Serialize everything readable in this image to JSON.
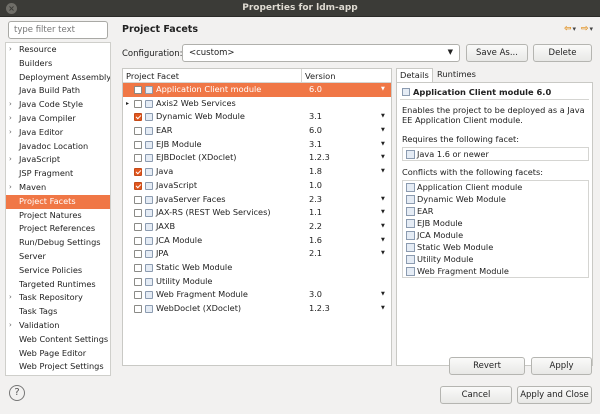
{
  "window": {
    "title": "Properties for ldm-app",
    "close": "×"
  },
  "filter": {
    "placeholder": "type filter text"
  },
  "nav": [
    {
      "label": "Resource",
      "arrow": "›"
    },
    {
      "label": "Builders",
      "arrow": ""
    },
    {
      "label": "Deployment Assembly",
      "arrow": ""
    },
    {
      "label": "Java Build Path",
      "arrow": ""
    },
    {
      "label": "Java Code Style",
      "arrow": "›"
    },
    {
      "label": "Java Compiler",
      "arrow": "›"
    },
    {
      "label": "Java Editor",
      "arrow": "›"
    },
    {
      "label": "Javadoc Location",
      "arrow": ""
    },
    {
      "label": "JavaScript",
      "arrow": "›"
    },
    {
      "label": "JSP Fragment",
      "arrow": ""
    },
    {
      "label": "Maven",
      "arrow": "›"
    },
    {
      "label": "Project Facets",
      "arrow": "",
      "selected": true
    },
    {
      "label": "Project Natures",
      "arrow": ""
    },
    {
      "label": "Project References",
      "arrow": ""
    },
    {
      "label": "Run/Debug Settings",
      "arrow": ""
    },
    {
      "label": "Server",
      "arrow": ""
    },
    {
      "label": "Service Policies",
      "arrow": ""
    },
    {
      "label": "Targeted Runtimes",
      "arrow": ""
    },
    {
      "label": "Task Repository",
      "arrow": "›"
    },
    {
      "label": "Task Tags",
      "arrow": ""
    },
    {
      "label": "Validation",
      "arrow": "›"
    },
    {
      "label": "Web Content Settings",
      "arrow": ""
    },
    {
      "label": "Web Page Editor",
      "arrow": ""
    },
    {
      "label": "Web Project Settings",
      "arrow": ""
    }
  ],
  "page": {
    "title": "Project Facets",
    "nav_back": "⇦",
    "nav_forward": "⇨",
    "nav_menu": "▾"
  },
  "config": {
    "label": "Configuration:",
    "value": "<custom>",
    "save_as": "Save As...",
    "delete": "Delete"
  },
  "facets": {
    "col_facet": "Project Facet",
    "col_version": "Version",
    "rows": [
      {
        "name": "Application Client module",
        "version": "6.0",
        "checked": false,
        "selected": true,
        "has_dd": true
      },
      {
        "name": "Axis2 Web Services",
        "version": "",
        "checked": false,
        "expander": "▸"
      },
      {
        "name": "Dynamic Web Module",
        "version": "3.1",
        "checked": true,
        "has_dd": true
      },
      {
        "name": "EAR",
        "version": "6.0",
        "checked": false,
        "has_dd": true
      },
      {
        "name": "EJB Module",
        "version": "3.1",
        "checked": false,
        "has_dd": true
      },
      {
        "name": "EJBDoclet (XDoclet)",
        "version": "1.2.3",
        "checked": false,
        "has_dd": true
      },
      {
        "name": "Java",
        "version": "1.8",
        "checked": true,
        "has_dd": true
      },
      {
        "name": "JavaScript",
        "version": "1.0",
        "checked": true
      },
      {
        "name": "JavaServer Faces",
        "version": "2.3",
        "checked": false,
        "has_dd": true
      },
      {
        "name": "JAX-RS (REST Web Services)",
        "version": "1.1",
        "checked": false,
        "has_dd": true
      },
      {
        "name": "JAXB",
        "version": "2.2",
        "checked": false,
        "has_dd": true
      },
      {
        "name": "JCA Module",
        "version": "1.6",
        "checked": false,
        "has_dd": true
      },
      {
        "name": "JPA",
        "version": "2.1",
        "checked": false,
        "has_dd": true
      },
      {
        "name": "Static Web Module",
        "version": "",
        "checked": false
      },
      {
        "name": "Utility Module",
        "version": "",
        "checked": false
      },
      {
        "name": "Web Fragment Module",
        "version": "3.0",
        "checked": false,
        "has_dd": true
      },
      {
        "name": "WebDoclet (XDoclet)",
        "version": "1.2.3",
        "checked": false,
        "has_dd": true
      }
    ]
  },
  "tabs": {
    "details": "Details",
    "runtimes": "Runtimes"
  },
  "details": {
    "title": "Application Client module 6.0",
    "description": "Enables the project to be deployed as a Java EE Application Client module.",
    "requires_label": "Requires the following facet:",
    "requires": [
      "Java 1.6 or newer"
    ],
    "conflicts_label": "Conflicts with the following facets:",
    "conflicts": [
      "Application Client module",
      "Dynamic Web Module",
      "EAR",
      "EJB Module",
      "JCA Module",
      "Static Web Module",
      "Utility Module",
      "Web Fragment Module"
    ]
  },
  "buttons": {
    "revert": "Revert",
    "apply": "Apply",
    "cancel": "Cancel",
    "apply_close": "Apply and Close",
    "help": "?"
  },
  "colors": {
    "accent": "#f07746",
    "titlebar": "#3b3b37"
  }
}
